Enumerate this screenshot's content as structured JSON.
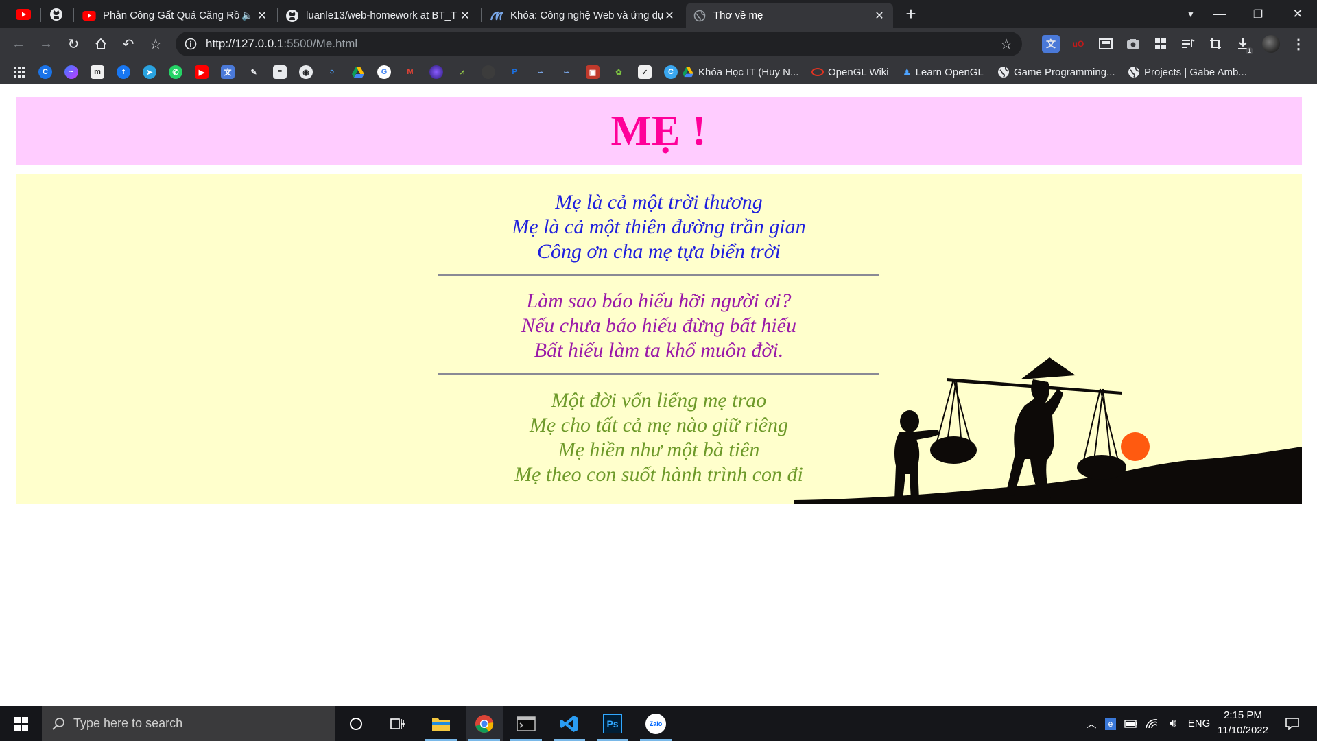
{
  "browser": {
    "tabs": [
      {
        "title": "Phản Công Gất Quá Căng Rồ",
        "favicon": "youtube-icon",
        "muted": true
      },
      {
        "title": "luanle13/web-homework at BT_T",
        "favicon": "github-icon"
      },
      {
        "title": "Khóa: Công nghệ Web và ứng dụ",
        "favicon": "moodle-icon"
      },
      {
        "title": "Thơ về mẹ",
        "favicon": "globe-icon",
        "active": true
      }
    ],
    "new_tab_label": "+",
    "url_host": "http://127.0.0.1",
    "url_path": ":5500/Me.html",
    "download_badge": "1",
    "bookmarks": [
      {
        "label": "Khóa Học IT (Huy N...",
        "icon": "drive-icon"
      },
      {
        "label": "OpenGL Wiki",
        "icon": "opengl-icon"
      },
      {
        "label": "Learn OpenGL",
        "icon": "learnopengl-icon"
      },
      {
        "label": "Game Programming...",
        "icon": "globe-icon"
      },
      {
        "label": "Projects | Gabe Amb...",
        "icon": "globe-icon"
      }
    ]
  },
  "page": {
    "title": "MẸ !",
    "stanzas": [
      {
        "lines": [
          "Mẹ là cả một trời thương",
          "Mẹ là cả một thiên đường trần gian",
          "Công ơn cha mẹ tựa biển trời"
        ],
        "color": "#1f1fdd"
      },
      {
        "lines": [
          "Làm sao báo hiếu hỡi người ơi?",
          "Nếu chưa báo hiếu đừng bất hiếu",
          "Bất hiếu làm ta khổ muôn đời."
        ],
        "color": "#9a1aa8"
      },
      {
        "lines": [
          "Một đời vốn liếng mẹ trao",
          "Mẹ cho tất cả mẹ nào giữ riêng",
          "Mẹ hiền như một bà tiên",
          "Mẹ theo con suốt hành trình con đi"
        ],
        "color": "#6e9a2a"
      }
    ],
    "colors": {
      "header_bg": "#ffccff",
      "title": "#ff0099",
      "poem_bg": "#ffffcc",
      "rule": "#8a8a95",
      "sun": "#ff5a10"
    }
  },
  "taskbar": {
    "search_placeholder": "Type here to search",
    "apps": [
      "file-explorer-icon",
      "chrome-icon",
      "terminal-icon",
      "vscode-icon",
      "photoshop-icon",
      "zalo-icon"
    ],
    "ps_label": "Ps",
    "zalo_label": "Zalo",
    "language": "ENG",
    "time": "2:15 PM",
    "date": "11/10/2022"
  }
}
